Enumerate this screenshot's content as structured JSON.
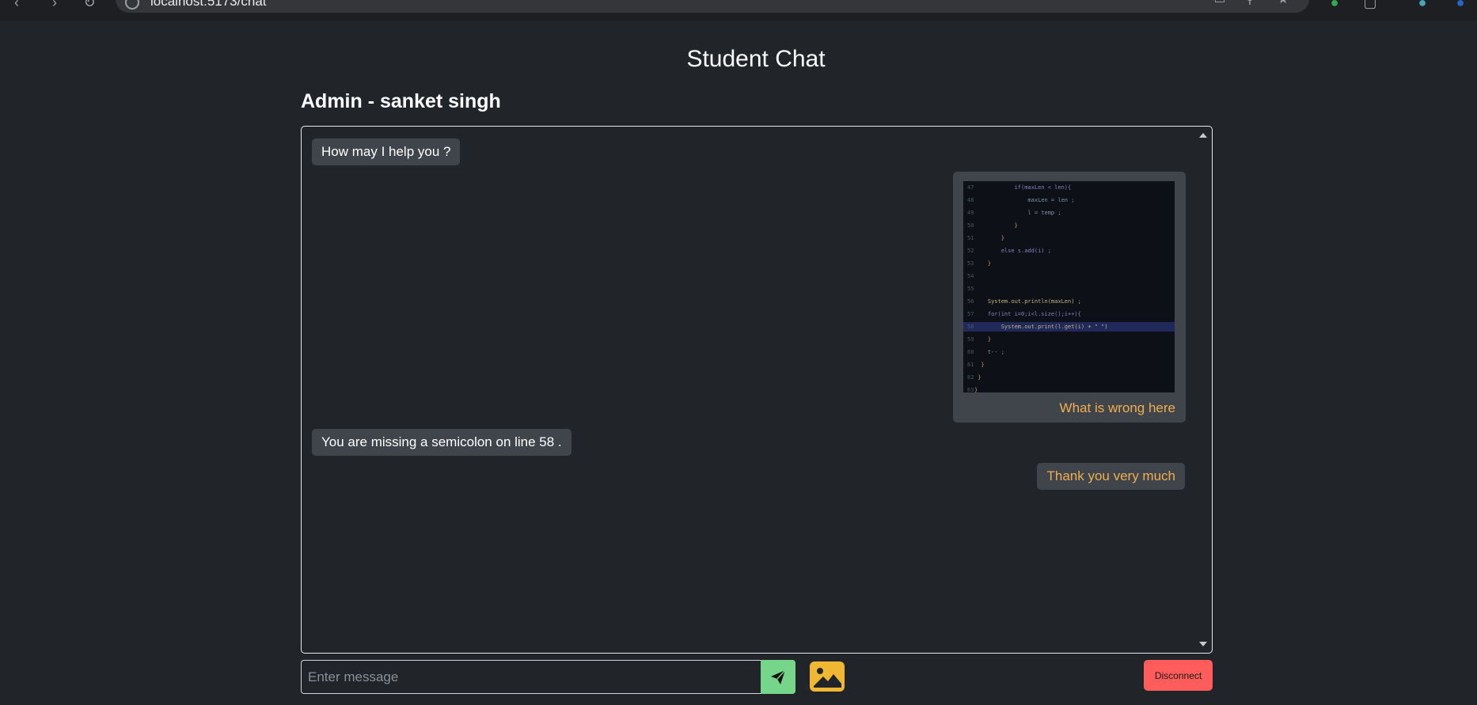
{
  "browser": {
    "url": "localhost:5173/chat"
  },
  "page": {
    "title": "Student Chat",
    "admin_heading": "Admin - sanket singh"
  },
  "messages": [
    {
      "sender": "admin",
      "text": "How may I help you ?"
    },
    {
      "sender": "student",
      "type": "image",
      "caption": "What is wrong here"
    },
    {
      "sender": "admin",
      "text": "You are missing a semicolon on line 58 ."
    },
    {
      "sender": "student",
      "text": "Thank you very much"
    }
  ],
  "code_screenshot": {
    "lines": [
      {
        "n": "47",
        "code": "            if(maxLen < len){"
      },
      {
        "n": "48",
        "code": "                maxLen = len ;"
      },
      {
        "n": "49",
        "code": "                l = temp ;"
      },
      {
        "n": "50",
        "code": "            }"
      },
      {
        "n": "51",
        "code": "        }"
      },
      {
        "n": "52",
        "code": "        else s.add(i) ;"
      },
      {
        "n": "53",
        "code": "    }"
      },
      {
        "n": "54",
        "code": ""
      },
      {
        "n": "55",
        "code": ""
      },
      {
        "n": "56",
        "code": "    System.out.println(maxLen) ;"
      },
      {
        "n": "57",
        "code": "    for(int i=0;i<l.size();i++){"
      },
      {
        "n": "58",
        "code": "        System.out.print(l.get(i) + \" \")"
      },
      {
        "n": "59",
        "code": "    }"
      },
      {
        "n": "60",
        "code": "    t-- ;"
      },
      {
        "n": "61",
        "code": "  }"
      },
      {
        "n": "62",
        "code": " }"
      },
      {
        "n": "63",
        "code": "}"
      }
    ],
    "highlighted_line": "58"
  },
  "input": {
    "placeholder": "Enter message",
    "value": ""
  },
  "buttons": {
    "send_icon": "paper-plane-icon",
    "image_icon": "image-upload-icon",
    "disconnect_label": "Disconnect"
  },
  "colors": {
    "background": "#212529",
    "bubble": "#40454c",
    "student_text": "#f0ad4e",
    "send_button": "#75d68a",
    "image_button": "#f0b733",
    "disconnect_button": "#ff5c5c"
  }
}
